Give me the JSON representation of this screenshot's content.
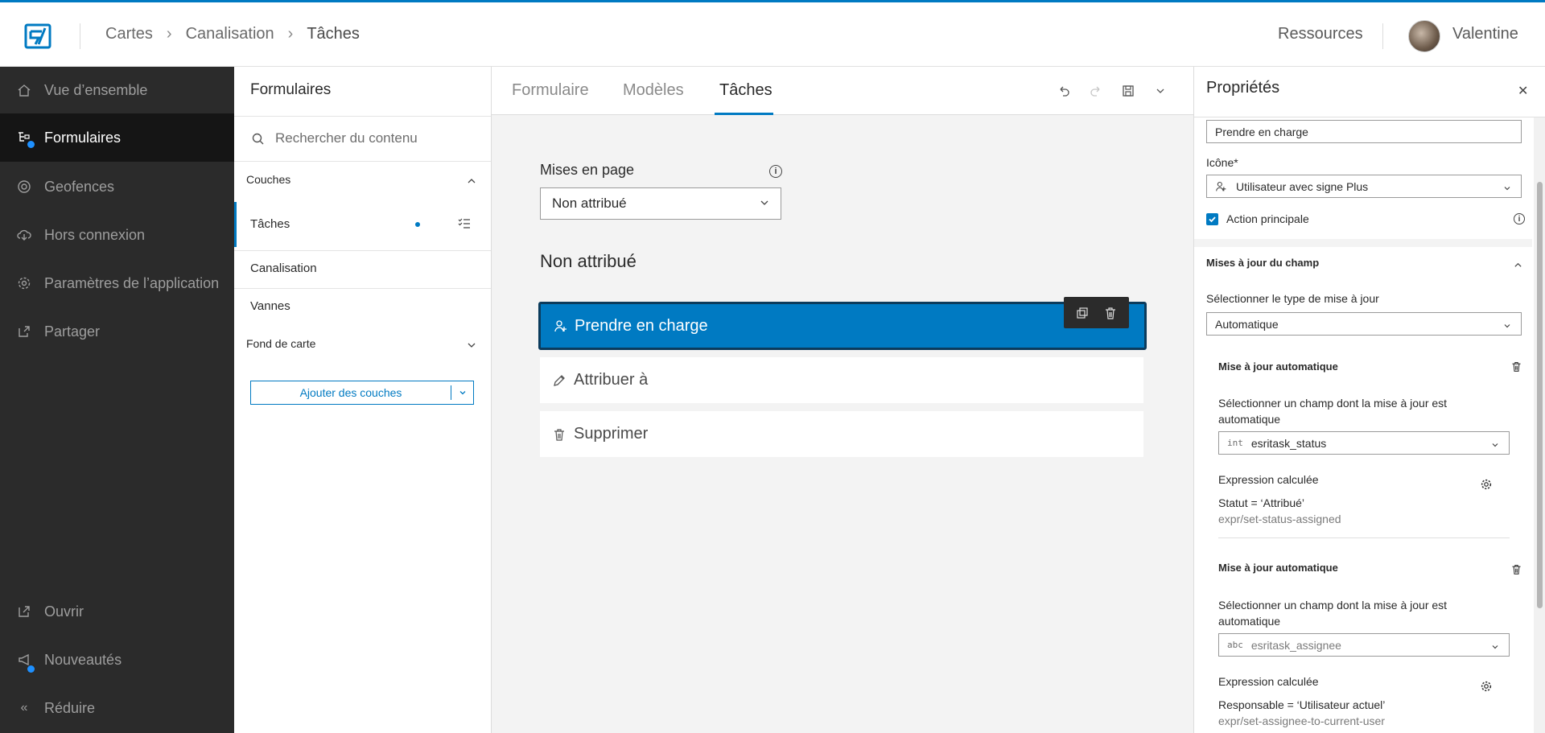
{
  "header": {
    "breadcrumbs": [
      "Cartes",
      "Canalisation",
      "Tâches"
    ],
    "resources": "Ressources",
    "user": "Valentine"
  },
  "nav": {
    "items": [
      {
        "label": "Vue d’ensemble",
        "icon": "home-icon"
      },
      {
        "label": "Formulaires",
        "icon": "form-tree-icon"
      },
      {
        "label": "Geofences",
        "icon": "target-icon"
      },
      {
        "label": "Hors connexion",
        "icon": "cloud-download-icon"
      },
      {
        "label": "Paramètres de l’application",
        "icon": "gear-icon"
      },
      {
        "label": "Partager",
        "icon": "share-icon"
      }
    ],
    "bottom": [
      {
        "label": "Ouvrir",
        "icon": "launch-icon"
      },
      {
        "label": "Nouveautés",
        "icon": "megaphone-icon"
      },
      {
        "label": "Réduire",
        "icon": "chevrons-left-icon"
      }
    ]
  },
  "layers": {
    "title": "Formulaires",
    "search_placeholder": "Rechercher du contenu",
    "section_couches": "Couches",
    "items": [
      "Tâches",
      "Canalisation",
      "Vannes"
    ],
    "section_fond": "Fond de carte",
    "add_button": "Ajouter des couches"
  },
  "center": {
    "tabs": [
      "Formulaire",
      "Modèles",
      "Tâches"
    ],
    "active_tab": "Tâches",
    "layout_label": "Mises en page",
    "layout_value": "Non attribué",
    "section_title": "Non attribué",
    "actions": [
      {
        "label": "Prendre en charge",
        "icon": "user-plus-icon"
      },
      {
        "label": "Attribuer à",
        "icon": "pencil-icon"
      },
      {
        "label": "Supprimer",
        "icon": "trash-icon"
      }
    ]
  },
  "props": {
    "title": "Propriétés",
    "name_value": "Prendre en charge",
    "icon_label": "Icône*",
    "icon_value": "Utilisateur avec signe Plus",
    "primary_label": "Action principale",
    "primary_checked": true,
    "field_updates_title": "Mises à jour du champ",
    "update_type_label": "Sélectionner le type de mise à jour",
    "update_type_value": "Automatique",
    "auto_updates": [
      {
        "title": "Mise à jour automatique",
        "field_label": "Sélectionner un champ dont la mise à jour est automatique",
        "field_type": "int",
        "field_value": "esritask_status",
        "expr_label": "Expression calculée",
        "expr_title": "Statut = ‘Attribué’",
        "expr_id": "expr/set-status-assigned"
      },
      {
        "title": "Mise à jour automatique",
        "field_label": "Sélectionner un champ dont la mise à jour est automatique",
        "field_type": "abc",
        "field_value": "esritask_assignee",
        "expr_label": "Expression calculée",
        "expr_title": "Responsable = ‘Utilisateur actuel’",
        "expr_id": "expr/set-assignee-to-current-user"
      }
    ]
  },
  "colors": {
    "accent": "#007ac2",
    "nav_bg": "#2b2b2b",
    "nav_active": "#151515"
  }
}
